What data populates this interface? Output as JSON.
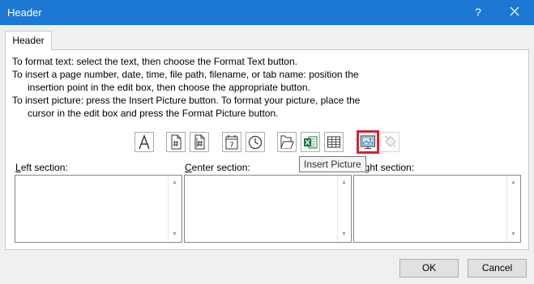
{
  "window": {
    "title": "Header",
    "help": "?"
  },
  "tab": {
    "label": "Header"
  },
  "instructions": {
    "line1": "To format text:  select the text, then choose the Format Text button.",
    "line2": "To insert a page number, date, time, file path, filename, or tab name:  position the",
    "line3": "insertion point in the edit box, then choose the appropriate button.",
    "line4": "To insert picture: press the Insert Picture button.  To format your picture, place the",
    "line5": "cursor in the edit box and press the Format Picture button."
  },
  "toolbar": {
    "buttons": [
      {
        "name": "format-text",
        "icon": "letter-a-icon"
      },
      {
        "name": "insert-page-number",
        "icon": "page-number-icon"
      },
      {
        "name": "insert-number-of-pages",
        "icon": "number-of-pages-icon"
      },
      {
        "name": "insert-date",
        "icon": "calendar-icon",
        "glyph": "7"
      },
      {
        "name": "insert-time",
        "icon": "clock-icon"
      },
      {
        "name": "insert-file-path",
        "icon": "folder-path-icon"
      },
      {
        "name": "insert-file-name",
        "icon": "excel-file-icon"
      },
      {
        "name": "insert-sheet-name",
        "icon": "sheet-grid-icon"
      },
      {
        "name": "insert-picture",
        "icon": "picture-icon",
        "highlighted": true
      },
      {
        "name": "format-picture",
        "icon": "paint-bucket-icon",
        "disabled": true
      }
    ],
    "tooltip": "Insert Picture",
    "highlight_color": "#d3232f"
  },
  "sections": {
    "left": {
      "label_u": "L",
      "label_rest": "eft section:"
    },
    "center": {
      "label_u": "C",
      "label_rest": "enter section:"
    },
    "right": {
      "label_visible": "ight section:"
    }
  },
  "buttons": {
    "ok": "OK",
    "cancel": "Cancel"
  },
  "colors": {
    "titlebar": "#1d78d4"
  }
}
